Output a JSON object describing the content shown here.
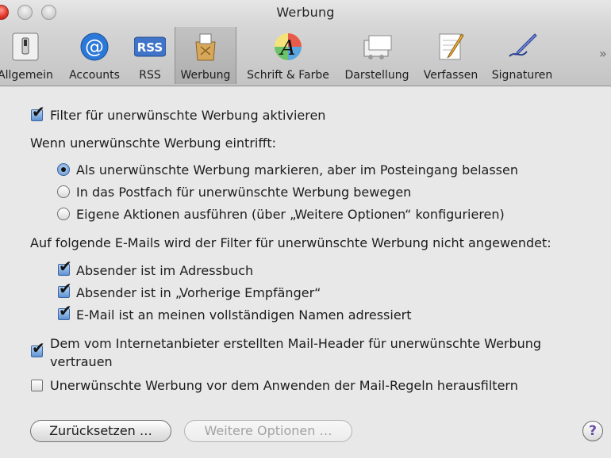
{
  "window": {
    "title": "Werbung"
  },
  "toolbar": {
    "items": [
      {
        "label": "Allgemein",
        "icon": "switch-icon"
      },
      {
        "label": "Accounts",
        "icon": "at-icon"
      },
      {
        "label": "RSS",
        "icon": "rss-icon"
      },
      {
        "label": "Werbung",
        "icon": "junk-mail-icon",
        "selected": true
      },
      {
        "label": "Schrift & Farbe",
        "icon": "font-color-icon"
      },
      {
        "label": "Darstellung",
        "icon": "viewing-icon"
      },
      {
        "label": "Verfassen",
        "icon": "composing-icon"
      },
      {
        "label": "Signaturen",
        "icon": "signature-pen-icon"
      }
    ],
    "overflow": "»"
  },
  "filter": {
    "label": "Filter für unerwünschte Werbung aktivieren",
    "checked": true
  },
  "when": {
    "heading": "Wenn unerwünschte Werbung eintrifft:",
    "options": [
      {
        "label": "Als unerwünschte Werbung markieren, aber im Posteingang belassen",
        "selected": true
      },
      {
        "label": "In das Postfach für unerwünschte Werbung bewegen",
        "selected": false
      },
      {
        "label": "Eigene Aktionen ausführen (über „Weitere Optionen“ konfigurieren)",
        "selected": false
      }
    ]
  },
  "exempt": {
    "heading": "Auf folgende E-Mails wird der Filter für unerwünschte Werbung nicht angewendet:",
    "items": [
      {
        "label": "Absender ist im Adressbuch",
        "checked": true
      },
      {
        "label": "Absender ist in „Vorherige Empfänger“",
        "checked": true
      },
      {
        "label": "E-Mail ist an meinen vollständigen Namen adressiert",
        "checked": true
      }
    ]
  },
  "trust_header": {
    "line1": "Dem vom Internetanbieter erstellten Mail-Header für unerwünschte Werbung",
    "line2": "vertrauen",
    "checked": true
  },
  "prefilter": {
    "label": "Unerwünschte Werbung vor dem Anwenden der Mail-Regeln herausfiltern",
    "checked": false
  },
  "buttons": {
    "reset": "Zurücksetzen …",
    "advanced": "Weitere Optionen …",
    "help": "?"
  },
  "colors": {
    "accent": "#5f93d4",
    "toolbar": "#c8c8c8",
    "background": "#e8e8e8"
  }
}
